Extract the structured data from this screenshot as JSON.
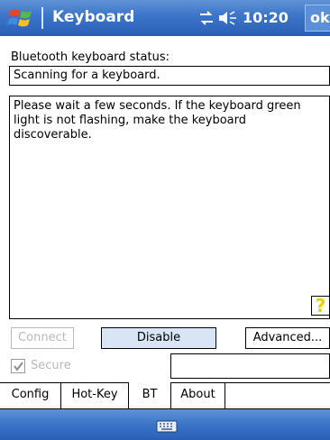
{
  "titlebar": {
    "title": "Keyboard",
    "time": "10:20",
    "ok_label": "ok",
    "icons": [
      "windows-start-flag",
      "connectivity-icon",
      "volume-icon"
    ]
  },
  "status": {
    "label": "Bluetooth keyboard status:",
    "value": "Scanning for a keyboard."
  },
  "message": {
    "text": "Please wait a few seconds. If the keyboard green light is not flashing, make the keyboard discoverable."
  },
  "help": {
    "label": "?"
  },
  "buttons": {
    "connect": "Connect",
    "disable": "Disable",
    "advanced": "Advanced..."
  },
  "secure": {
    "label": "Secure",
    "checked": true
  },
  "tabs": [
    {
      "label": "Config"
    },
    {
      "label": "Hot-Key"
    },
    {
      "label": "BT",
      "active": true
    },
    {
      "label": "About"
    }
  ],
  "colors": {
    "titlebar": "#3a74c8",
    "button_fill": "#d7e5f5",
    "disabled_text": "#b9b9b9",
    "help_mark": "#e8d000"
  }
}
